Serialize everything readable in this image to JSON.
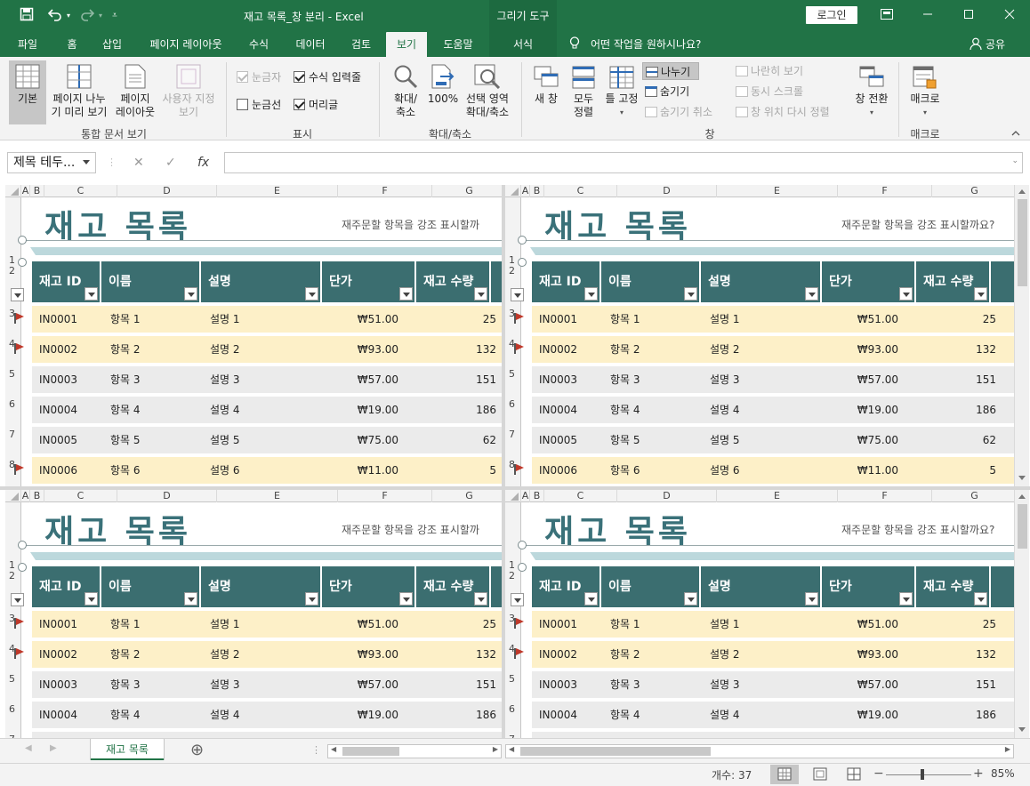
{
  "window": {
    "title": "재고 목록_창 분리  -  Excel",
    "context_group": "그리기 도구",
    "login_label": "로그인",
    "theme_color": "#217346"
  },
  "quick_access": {
    "save_icon": "save-icon",
    "undo_icon": "undo-icon",
    "redo_icon": "redo-icon",
    "customize_icon": "customize-icon"
  },
  "ribbon_tabs": [
    {
      "label": "파일"
    },
    {
      "label": "홈"
    },
    {
      "label": "삽입"
    },
    {
      "label": "페이지 레이아웃"
    },
    {
      "label": "수식"
    },
    {
      "label": "데이터"
    },
    {
      "label": "검토"
    },
    {
      "label": "보기"
    },
    {
      "label": "도움말"
    },
    {
      "label": "서식"
    }
  ],
  "active_tab": "보기",
  "tell_me": "어떤 작업을 원하시나요?",
  "share_label": "공유",
  "ribbon": {
    "workbook_views": {
      "normal": "기본",
      "page_break_1": "페이지 나누",
      "page_break_2": "기 미리 보기",
      "page_layout_1": "페이지",
      "page_layout_2": "레이아웃",
      "custom_1": "사용자 지정",
      "custom_2": "보기",
      "group": "통합 문서 보기"
    },
    "show": {
      "ruler": "눈금자",
      "formula_bar": "수식 입력줄",
      "gridlines": "눈금선",
      "headings": "머리글",
      "group": "표시"
    },
    "zoom": {
      "zoom_1": "확대/",
      "zoom_2": "축소",
      "hundred": "100%",
      "selection_1": "선택 영역",
      "selection_2": "확대/축소",
      "group": "확대/축소"
    },
    "window": {
      "new_window": "새 창",
      "arrange_1": "모두",
      "arrange_2": "정렬",
      "freeze": "틀 고정",
      "split": "나누기",
      "hide": "숨기기",
      "unhide": "숨기기 취소",
      "side_by_side": "나란히 보기",
      "sync_scroll": "동시 스크롤",
      "reset_pos": "창 위치 다시 정렬",
      "switch": "창 전환",
      "group": "창"
    },
    "macros": {
      "macros": "매크로",
      "group": "매크로"
    }
  },
  "formula_bar": {
    "name_box": "제목 테두...",
    "cancel_icon": "✕",
    "enter_icon": "✓",
    "fx_label": "fx",
    "content": ""
  },
  "columns_left": [
    "A",
    "B",
    "C",
    "D",
    "E",
    "F",
    "G"
  ],
  "columns_right": [
    "A",
    "B",
    "C",
    "D",
    "E",
    "F",
    "G"
  ],
  "sheet": {
    "title": "재고 목록",
    "hint_left": "재주문할 항목을 강조 표시할까",
    "hint_right": "재주문할 항목을 강조 표시할까요?",
    "headers": [
      "재고 ID",
      "이름",
      "설명",
      "단가",
      "재고 수량"
    ],
    "rows": [
      {
        "row": "4",
        "flag": true,
        "id": "IN0001",
        "name": "항목 1",
        "desc": "설명 1",
        "price": "₩51.00",
        "qty": "25"
      },
      {
        "row": "5",
        "flag": true,
        "id": "IN0002",
        "name": "항목 2",
        "desc": "설명 2",
        "price": "₩93.00",
        "qty": "132"
      },
      {
        "row": "6",
        "flag": false,
        "id": "IN0003",
        "name": "항목 3",
        "desc": "설명 3",
        "price": "₩57.00",
        "qty": "151"
      },
      {
        "row": "7",
        "flag": false,
        "id": "IN0004",
        "name": "항목 4",
        "desc": "설명 4",
        "price": "₩19.00",
        "qty": "186"
      },
      {
        "row": "8",
        "flag": false,
        "id": "IN0005",
        "name": "항목 5",
        "desc": "설명 5",
        "price": "₩75.00",
        "qty": "62"
      },
      {
        "row": "9",
        "flag": true,
        "id": "IN0006",
        "name": "항목 6",
        "desc": "설명 6",
        "price": "₩11.00",
        "qty": "5"
      }
    ],
    "row_headers_top": [
      "1",
      "2",
      "3",
      "4",
      "5",
      "6",
      "7",
      "8",
      "9"
    ],
    "highlight_color": "#fdf0c8",
    "header_color": "#3b6e70",
    "title_color": "#3a7179"
  },
  "sheet_tabs": [
    {
      "label": "재고 목록"
    }
  ],
  "add_sheet_icon": "⊕",
  "status": {
    "count": "개수: 37",
    "zoom": "85%",
    "zoom_level": 0.85
  }
}
